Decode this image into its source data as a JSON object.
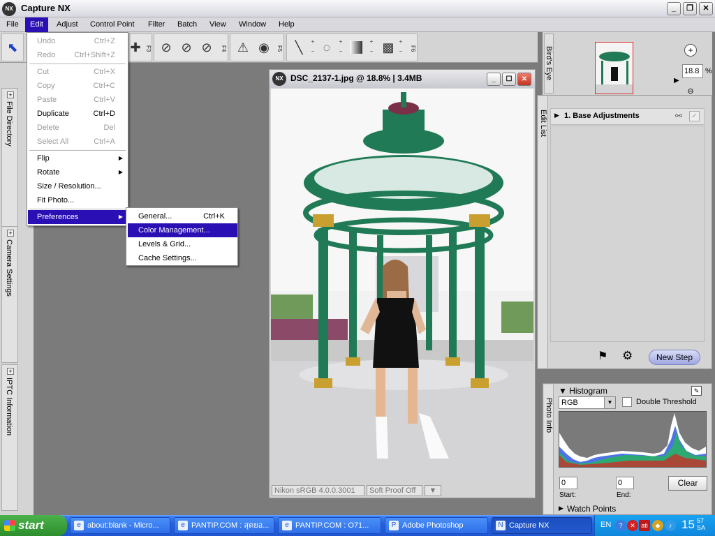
{
  "window": {
    "title": "Capture NX"
  },
  "menubar": [
    "File",
    "Edit",
    "Adjust",
    "Control Point",
    "Filter",
    "Batch",
    "View",
    "Window",
    "Help"
  ],
  "toolbar": {
    "fkeys": [
      "F3",
      "F4",
      "F5",
      "F6"
    ]
  },
  "edit_menu": {
    "items": [
      {
        "label": "Undo",
        "shortcut": "Ctrl+Z"
      },
      {
        "label": "Redo",
        "shortcut": "Ctrl+Shift+Z"
      },
      {
        "label": "Cut",
        "shortcut": "Ctrl+X"
      },
      {
        "label": "Copy",
        "shortcut": "Ctrl+C"
      },
      {
        "label": "Paste",
        "shortcut": "Ctrl+V"
      },
      {
        "label": "Duplicate",
        "shortcut": "Ctrl+D"
      },
      {
        "label": "Delete",
        "shortcut": "Del"
      },
      {
        "label": "Select All",
        "shortcut": "Ctrl+A"
      },
      {
        "label": "Flip",
        "shortcut": ""
      },
      {
        "label": "Rotate",
        "shortcut": ""
      },
      {
        "label": "Size / Resolution...",
        "shortcut": ""
      },
      {
        "label": "Fit Photo...",
        "shortcut": ""
      },
      {
        "label": "Preferences",
        "shortcut": ""
      }
    ]
  },
  "preferences_submenu": {
    "items": [
      {
        "label": "General...",
        "shortcut": "Ctrl+K"
      },
      {
        "label": "Color Management...",
        "shortcut": ""
      },
      {
        "label": "Levels & Grid...",
        "shortcut": ""
      },
      {
        "label": "Cache Settings...",
        "shortcut": ""
      }
    ]
  },
  "left_panel": {
    "tabs": [
      "File Directory",
      "Camera Settings",
      "IPTC Information"
    ]
  },
  "image_window": {
    "title": "DSC_2137-1.jpg @ 18.8% | 3.4MB",
    "status_profile": "Nikon sRGB 4.0.0.3001",
    "status_proof": "Soft Proof Off"
  },
  "birds_eye": {
    "label": "Bird's Eye",
    "zoom_value": "18.8",
    "zoom_unit": "%"
  },
  "edit_list": {
    "label": "Edit List",
    "step": "1. Base Adjustments",
    "new_step": "New Step"
  },
  "photo_info": {
    "label": "Photo Info",
    "histogram_title": "Histogram",
    "channel": "RGB",
    "double_threshold": "Double Threshold",
    "start_value": "0",
    "end_value": "0",
    "start_label": "Start:",
    "end_label": "End:",
    "clear": "Clear",
    "watch_points": "Watch Points"
  },
  "taskbar": {
    "start": "start",
    "tasks": [
      "about:blank - Micro...",
      "PANTIP.COM : สุดยอ...",
      "PANTIP.COM : O71...",
      "Adobe Photoshop",
      "Capture NX"
    ],
    "lang": "EN",
    "clock": "15",
    "clock_minutes": "57",
    "clock_suffix": "SA"
  },
  "colors": {
    "menu_highlight": "#2a0fb5",
    "taskbar": "#2461de",
    "start": "#2d8d2d"
  }
}
